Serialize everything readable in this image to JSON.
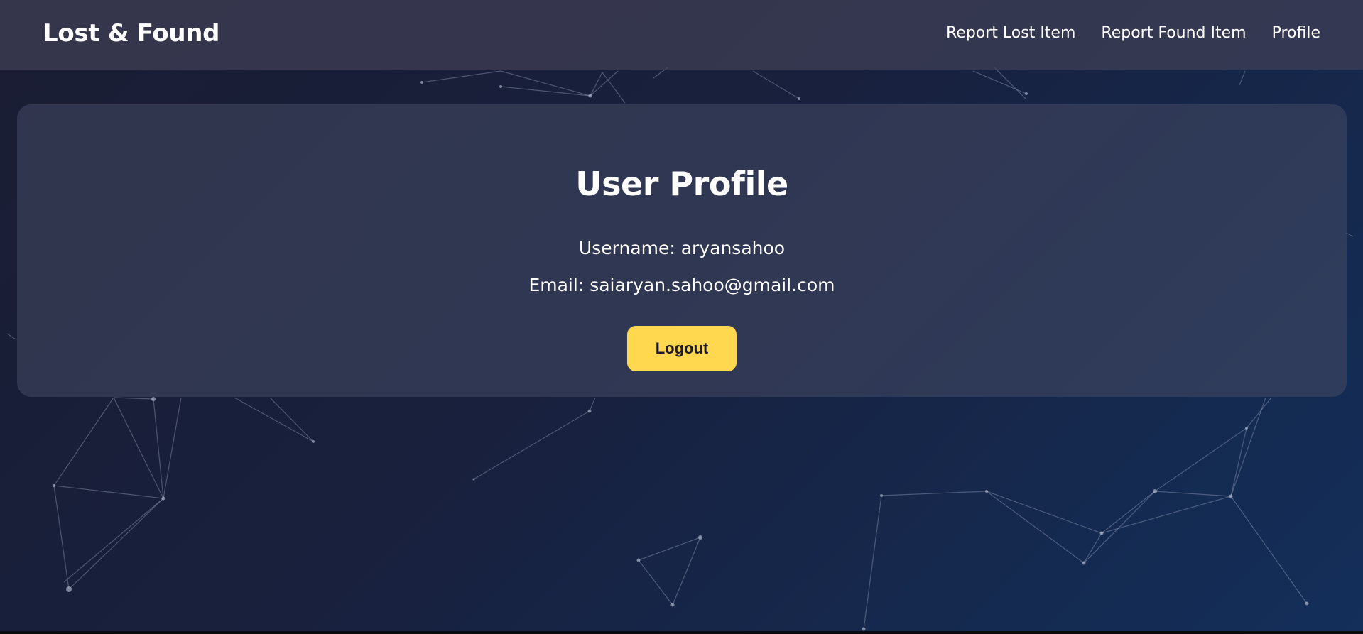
{
  "header": {
    "brand": "Lost & Found",
    "nav": [
      {
        "label": "Report Lost Item"
      },
      {
        "label": "Report Found Item"
      },
      {
        "label": "Profile"
      }
    ]
  },
  "profile": {
    "title": "User Profile",
    "username_label": "Username:",
    "username_value": "aryansahoo",
    "email_label": "Email:",
    "email_value": "saiaryan.sahoo@gmail.com",
    "logout_label": "Logout"
  },
  "colors": {
    "accent_button": "#ffd84f",
    "background_dark": "#1a1d33",
    "background_blue": "#132f5a"
  }
}
